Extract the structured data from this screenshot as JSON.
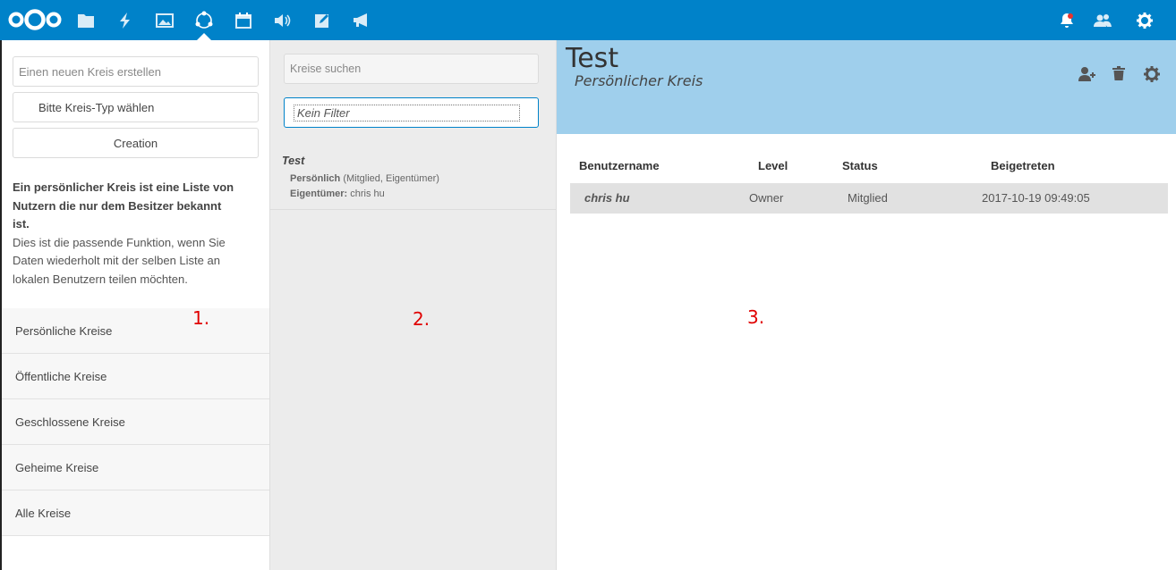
{
  "topbar": {
    "apps": [
      "files",
      "activity",
      "gallery",
      "circles",
      "calendar",
      "audio",
      "notes",
      "announcements"
    ],
    "right": [
      "notifications",
      "contacts",
      "settings"
    ]
  },
  "column1": {
    "new_circle_placeholder": "Einen neuen Kreis erstellen",
    "type_select": "Bitte Kreis-Typ wählen",
    "creation_button": "Creation",
    "description_bold": "Ein persönlicher Kreis ist eine Liste von Nutzern die nur dem Besitzer bekannt ist.",
    "description_text": "Dies ist die passende Funktion, wenn Sie Daten wiederholt mit der selben Liste an lokalen Benutzern teilen möchten.",
    "nav": [
      "Persönliche Kreise",
      "Öffentliche Kreise",
      "Geschlossene Kreise",
      "Geheime Kreise",
      "Alle Kreise"
    ]
  },
  "column2": {
    "search_placeholder": "Kreise suchen",
    "filter_placeholder": "Kein Filter",
    "circle": {
      "name": "Test",
      "type": "Persönlich",
      "membership": "(Mitglied, Eigentümer)",
      "owner_label": "Eigentümer:",
      "owner": "chris hu"
    }
  },
  "column3": {
    "title": "Test",
    "subtitle": "Persönlicher Kreis",
    "headers": {
      "username": "Benutzername",
      "level": "Level",
      "status": "Status",
      "joined": "Beigetreten"
    },
    "rows": [
      {
        "username": "chris hu",
        "level": "Owner",
        "status": "Mitglied",
        "joined": "2017-10-19 09:49:05"
      }
    ]
  },
  "annotations": [
    "1.",
    "2.",
    "3."
  ],
  "colors": {
    "brand": "#0082c9",
    "header_bg": "#9fcfec",
    "annotation": "#e00000"
  }
}
